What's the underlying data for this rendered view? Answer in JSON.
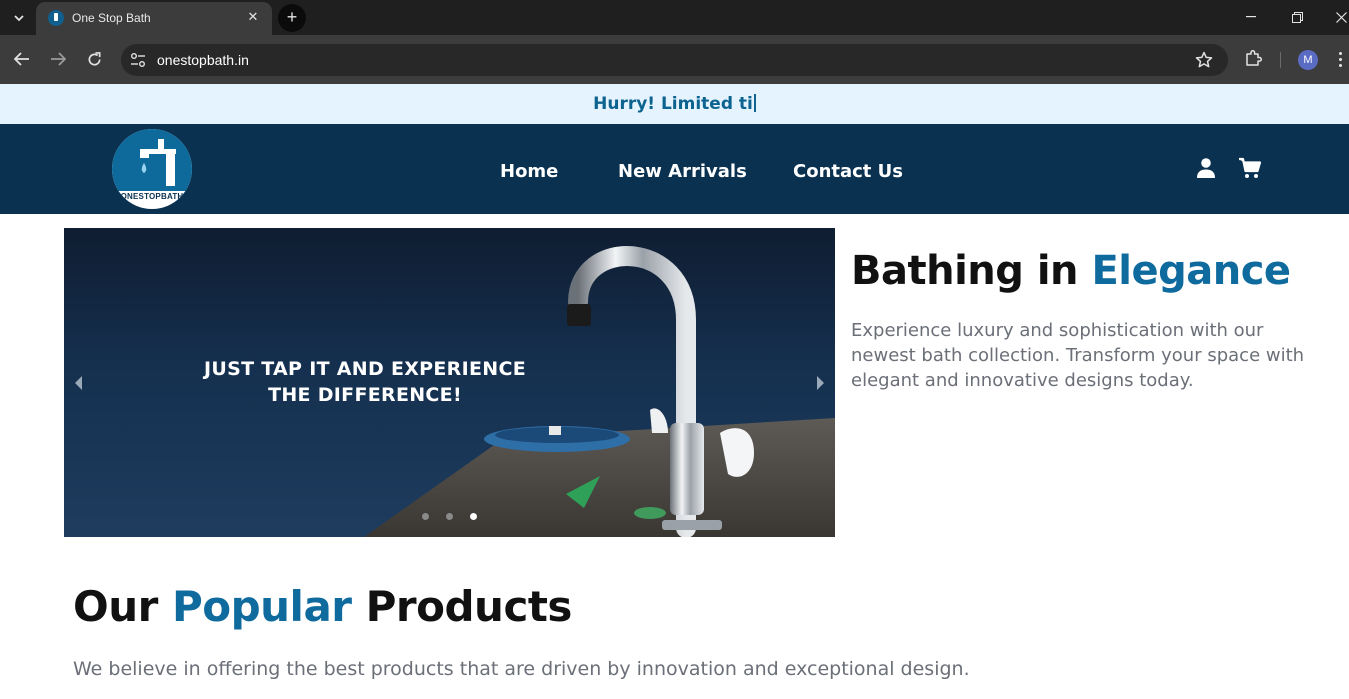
{
  "browser": {
    "tab_title": "One Stop Bath",
    "url": "onestopbath.in",
    "profile_initial": "M"
  },
  "announcement": {
    "text": "Hurry! Limited ti"
  },
  "nav": {
    "logo_text": "ONESTOPBATH",
    "links": [
      "Home",
      "New Arrivals",
      "Contact Us"
    ]
  },
  "hero": {
    "caption_line1": "JUST TAP IT AND EXPERIENCE",
    "caption_line2": "THE DIFFERENCE!",
    "slide_count": 3,
    "active_slide": 3
  },
  "intro": {
    "title_plain": "Bathing in ",
    "title_accent": "Elegance",
    "description": "Experience luxury and sophistication with our newest bath collection. Transform your space with elegant and innovative designs today."
  },
  "products": {
    "title_pre": "Our ",
    "title_accent": "Popular",
    "title_post": " Products",
    "description": "We believe in offering the best products that are driven by innovation and exceptional design."
  },
  "colors": {
    "navbar": "#0a3150",
    "accent": "#0f6a9e",
    "announcement_bg": "#e4f3fd"
  }
}
